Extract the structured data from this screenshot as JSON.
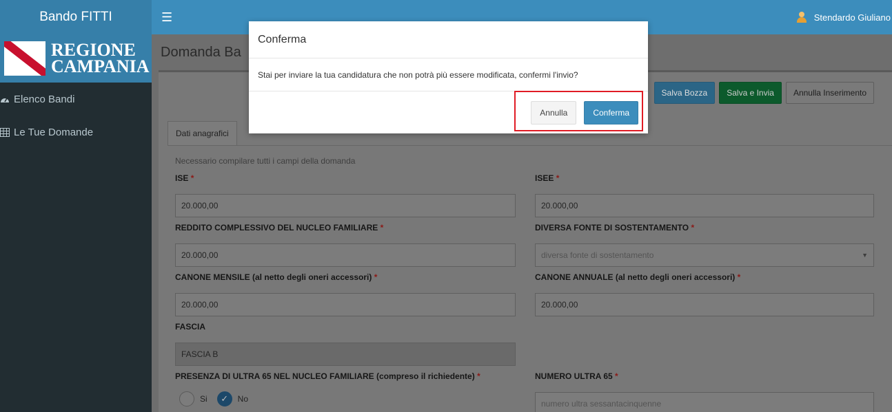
{
  "header": {
    "brand": "Bando FITTI",
    "menu_icon": "hamburger-icon",
    "user_name": "Stendardo Giuliano",
    "user_icon": "user-avatar-icon"
  },
  "sidebar": {
    "logo_line1": "REGIONE",
    "logo_line2": "CAMPANIA",
    "items": [
      {
        "label": "Elenco Bandi",
        "icon": "dashboard-icon"
      },
      {
        "label": "Le Tue Domande",
        "icon": "table-icon"
      }
    ]
  },
  "page": {
    "title": "Domanda Ba"
  },
  "toolbar": {
    "save_draft_label": "Salva Bozza",
    "save_send_label": "Salva e Invia",
    "cancel_insert_label": "Annulla Inserimento"
  },
  "tabs": [
    {
      "label": "Dati anagrafici"
    }
  ],
  "form": {
    "hint": "Necessario compilare tutti i campi della domanda",
    "required_marker": "*",
    "ise": {
      "label": "ISE",
      "value": "20.000,00"
    },
    "isee": {
      "label": "ISEE",
      "value": "20.000,00"
    },
    "reddito": {
      "label": "REDDITO COMPLESSIVO DEL NUCLEO FAMILIARE",
      "value": "20.000,00"
    },
    "fonte": {
      "label": "DIVERSA FONTE DI SOSTENTAMENTO",
      "placeholder": "diversa fonte di sostentamento"
    },
    "canone_mensile": {
      "label": "CANONE MENSILE (al netto degli oneri accessori)",
      "value": "20.000,00"
    },
    "canone_annuale": {
      "label": "CANONE ANNUALE (al netto degli oneri accessori)",
      "value": "20.000,00"
    },
    "fascia": {
      "label": "FASCIA",
      "value": "FASCIA B"
    },
    "ultra65": {
      "label": "PRESENZA DI ULTRA 65 NEL NUCLEO FAMILIARE (compreso il richiedente)",
      "option_yes": "Si",
      "option_no": "No",
      "selected": "No"
    },
    "numero_ultra65": {
      "label": "NUMERO ULTRA 65",
      "placeholder": "numero ultra sessantacinquenne"
    }
  },
  "modal": {
    "title": "Conferma",
    "message": "Stai per inviare la tua candidatura che non potrà più essere modificata, confermi l'invio?",
    "cancel_label": "Annulla",
    "confirm_label": "Conferma"
  },
  "colors": {
    "header": "#3c8dbc",
    "brand": "#367fa9",
    "sidebar": "#222d32",
    "primary": "#3c8dbc",
    "highlight": "#e01b24",
    "required": "#dd4b39"
  }
}
